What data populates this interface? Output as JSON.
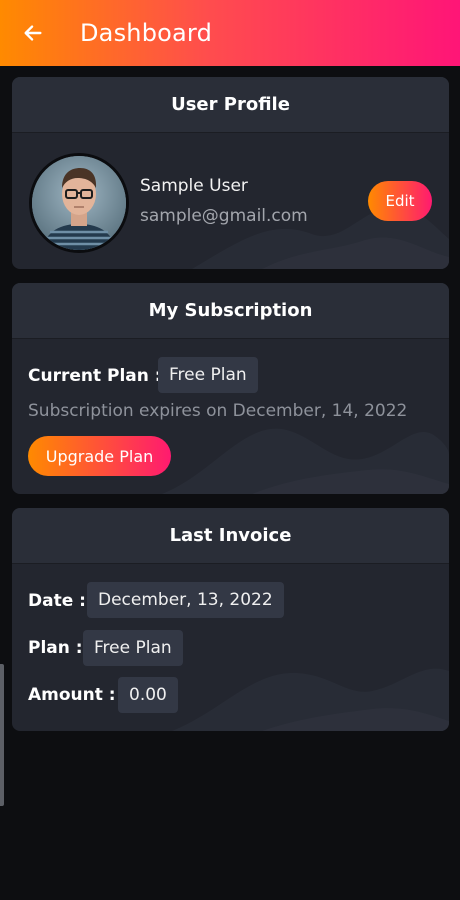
{
  "header": {
    "title": "Dashboard",
    "back_icon": "arrow-left-icon"
  },
  "profile": {
    "title": "User Profile",
    "name": "Sample User",
    "email": "sample@gmail.com",
    "edit_label": "Edit",
    "avatar_icon": "user-avatar"
  },
  "subscription": {
    "title": "My Subscription",
    "current_plan_label": "Current Plan :",
    "current_plan_value": "Free Plan",
    "expires_text": "Subscription expires on December,  14, 2022",
    "upgrade_label": "Upgrade Plan"
  },
  "invoice": {
    "title": "Last Invoice",
    "date_label": "Date :",
    "date_value": "December,  13, 2022",
    "plan_label": "Plan :",
    "plan_value": "Free Plan",
    "amount_label": "Amount :",
    "amount_value": "0.00"
  },
  "colors": {
    "gradient_start": "#ff8a00",
    "gradient_end": "#ff1577",
    "background": "#0d0e11",
    "card": "#23262f",
    "card_header": "#2a2e38",
    "chip": "#333845"
  }
}
